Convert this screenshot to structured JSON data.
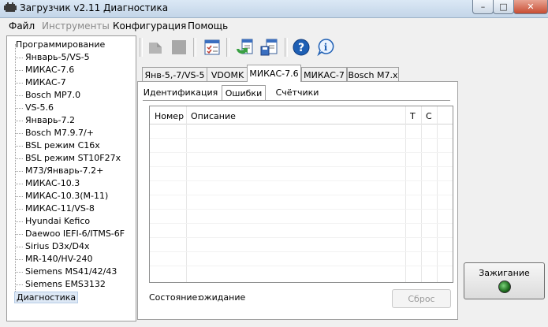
{
  "window": {
    "title": "Загрузчик v2.11 Диагностика",
    "minimize_label": "–",
    "maximize_label": "□",
    "close_label": "✕"
  },
  "menu": [
    "Файл",
    "Инструменты",
    "Конфигурация",
    "Помощь"
  ],
  "tree": {
    "root": "Программирование",
    "children": [
      "Январь-5/VS-5",
      "МИКАС-7.6",
      "МИКАС-7",
      "Bosch MP7.0",
      "VS-5.6",
      "Январь-7.2",
      "Bosch M7.9.7/+",
      "BSL режим C16x",
      "BSL режим ST10F27x",
      "M73/Январь-7.2+",
      "МИКАС-10.3",
      "МИКАС-10.3(M-11)",
      "МИКАС-11/VS-8",
      "Hyundai Kefico",
      "Daewoo IEFI-6/ITMS-6F",
      "Sirius D3x/D4x",
      "MR-140/HV-240",
      "Siemens MS41/42/43",
      "Siemens EMS3132"
    ],
    "selected": "Диагностика"
  },
  "tabs": [
    "Янв-5,-7/VS-5",
    "VDOMK",
    "МИКАС-7.6",
    "МИКАС-7",
    "Bosch M7.x"
  ],
  "subtabs": [
    "Идентификация",
    "Ошибки",
    "Счётчики"
  ],
  "grid": {
    "columns": [
      "Номер",
      "Описание",
      "T",
      "C"
    ]
  },
  "status": {
    "label": "Состояние:",
    "value": "ожидание"
  },
  "reset_label": "Сброс",
  "ignition_label": "Зажигание",
  "colors": {
    "led": "#2e8b2e",
    "title_bar": "#c3d5e8"
  },
  "icons": [
    "app-icon",
    "read-icon",
    "stop-icon",
    "checklist-icon",
    "load-icon",
    "save-icon",
    "help-icon",
    "info-icon"
  ]
}
